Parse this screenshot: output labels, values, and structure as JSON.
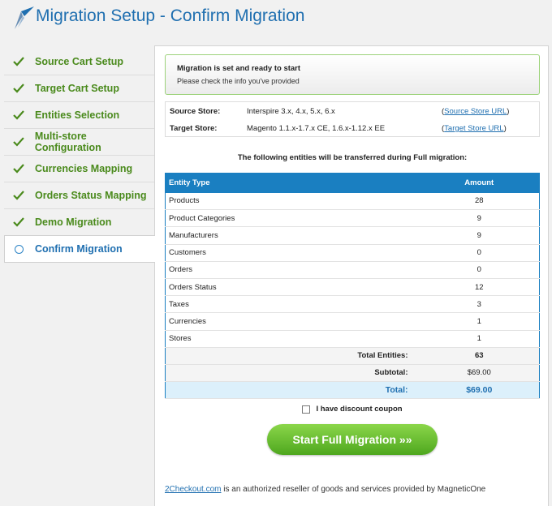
{
  "header": {
    "title": "Migration Setup - Confirm Migration"
  },
  "sidebar": {
    "items": [
      {
        "label": "Source Cart Setup",
        "state": "done"
      },
      {
        "label": "Target Cart Setup",
        "state": "done"
      },
      {
        "label": "Entities Selection",
        "state": "done"
      },
      {
        "label": "Multi-store Configuration",
        "state": "done"
      },
      {
        "label": "Currencies Mapping",
        "state": "done"
      },
      {
        "label": "Orders Status Mapping",
        "state": "done"
      },
      {
        "label": "Demo Migration",
        "state": "done"
      },
      {
        "label": "Confirm Migration",
        "state": "active"
      }
    ]
  },
  "notice": {
    "title": "Migration is set and ready to start",
    "subtitle": "Please check the info you've provided"
  },
  "stores": {
    "source": {
      "label": "Source Store:",
      "value": "Interspire 3.x, 4.x, 5.x, 6.x",
      "link": "Source Store URL"
    },
    "target": {
      "label": "Target Store:",
      "value": "Magento 1.1.x-1.7.x CE, 1.6.x-1.12.x EE",
      "link": "Target Store URL"
    }
  },
  "intro": "The following entities will be transferred during Full migration:",
  "table": {
    "headers": {
      "type": "Entity Type",
      "amount": "Amount"
    },
    "rows": [
      {
        "type": "Products",
        "amount": "28"
      },
      {
        "type": "Product Categories",
        "amount": "9"
      },
      {
        "type": "Manufacturers",
        "amount": "9"
      },
      {
        "type": "Customers",
        "amount": "0"
      },
      {
        "type": "Orders",
        "amount": "0"
      },
      {
        "type": "Orders Status",
        "amount": "12"
      },
      {
        "type": "Taxes",
        "amount": "3"
      },
      {
        "type": "Currencies",
        "amount": "1"
      },
      {
        "type": "Stores",
        "amount": "1"
      }
    ],
    "total_entities": {
      "label": "Total Entities:",
      "value": "63"
    },
    "subtotal": {
      "label": "Subtotal:",
      "value": "$69.00"
    },
    "total": {
      "label": "Total:",
      "value": "$69.00"
    }
  },
  "coupon": {
    "label": "I have discount coupon"
  },
  "start_button": {
    "label": "Start Full Migration »»"
  },
  "footer": {
    "link": "2Checkout.com",
    "text": "is an authorized reseller of goods and services provided by MagneticOne"
  },
  "colors": {
    "accent": "#1f6fb0",
    "done": "#4a8a1c",
    "button": "#5cb82a",
    "table_header": "#1a7fc1"
  }
}
